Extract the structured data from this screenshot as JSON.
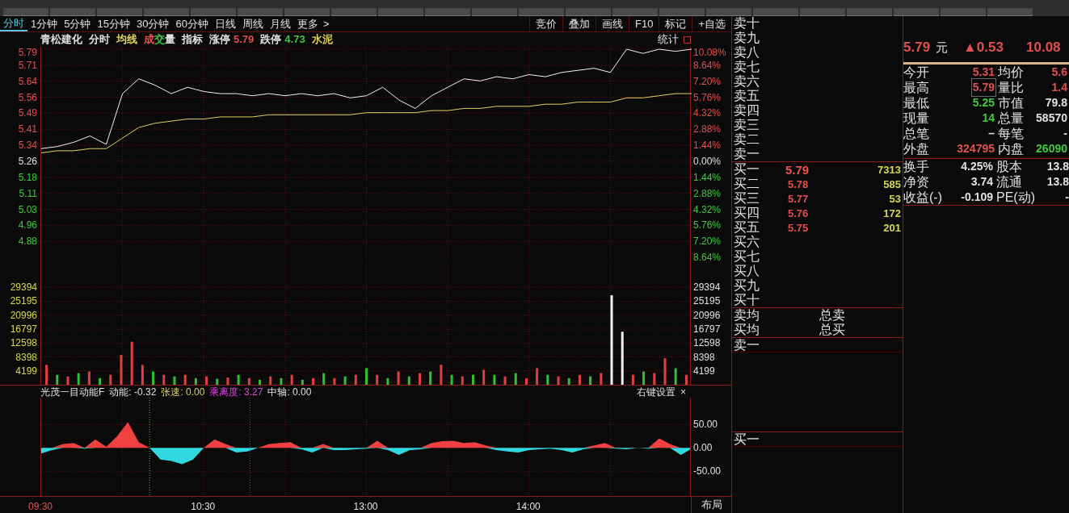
{
  "period_tabs": [
    {
      "label": "分时",
      "selected": true
    },
    {
      "label": "1分钟",
      "selected": false
    },
    {
      "label": "5分钟",
      "selected": false
    },
    {
      "label": "15分钟",
      "selected": false
    },
    {
      "label": "30分钟",
      "selected": false
    },
    {
      "label": "60分钟",
      "selected": false
    },
    {
      "label": "日线",
      "selected": false
    },
    {
      "label": "周线",
      "selected": false
    },
    {
      "label": "月线",
      "selected": false
    },
    {
      "label": "更多",
      "selected": false
    }
  ],
  "more_arrow": ">",
  "tool_buttons": [
    "竞价",
    "叠加",
    "画线",
    "F10",
    "标记",
    "+自选"
  ],
  "chart_header": {
    "items": [
      {
        "parts": [
          {
            "text": "青松建化",
            "color": "#e0e0e0"
          }
        ]
      },
      {
        "parts": [
          {
            "text": "分时",
            "color": "#e0e0e0"
          }
        ]
      },
      {
        "parts": [
          {
            "text": "均线",
            "color": "#e0d060"
          }
        ]
      },
      {
        "parts": [
          {
            "text": "成",
            "color": "#f05050"
          },
          {
            "text": "交",
            "color": "#40c840"
          },
          {
            "text": "量",
            "color": "#e0e0e0"
          }
        ]
      },
      {
        "parts": [
          {
            "text": "指标",
            "color": "#e0e0e0"
          }
        ]
      },
      {
        "parts": [
          {
            "text": "涨停",
            "color": "#e0e0e0"
          },
          {
            "text": "5.79",
            "color": "#e05050"
          }
        ]
      },
      {
        "parts": [
          {
            "text": "跌停",
            "color": "#e0e0e0"
          },
          {
            "text": "4.73",
            "color": "#40c840"
          }
        ]
      },
      {
        "parts": [
          {
            "text": "水泥",
            "color": "#e0d060"
          }
        ]
      }
    ],
    "stats_label": "统计"
  },
  "price_chart": {
    "chart_data": {
      "type": "line",
      "categories": [
        null,
        null,
        null,
        null,
        null,
        null,
        null,
        null,
        null,
        null,
        null,
        null,
        null,
        null,
        null,
        null,
        null,
        null,
        null,
        null,
        null,
        null,
        null,
        null,
        null,
        null,
        null,
        null,
        null,
        null,
        null,
        null,
        null,
        null,
        null,
        null,
        null,
        null,
        null,
        null,
        null
      ],
      "series": [
        {
          "color": "#f0f0f0",
          "values": [
            5.32,
            5.33,
            5.35,
            5.38,
            5.34,
            5.58,
            5.65,
            5.62,
            5.58,
            5.61,
            5.59,
            5.58,
            5.58,
            5.57,
            5.58,
            5.57,
            5.58,
            5.57,
            5.58,
            5.56,
            5.57,
            5.61,
            5.55,
            5.51,
            5.57,
            5.61,
            5.65,
            5.64,
            5.66,
            5.65,
            5.67,
            5.66,
            5.68,
            5.69,
            5.7,
            5.68,
            5.79,
            5.77,
            5.79,
            5.78,
            5.79
          ]
        },
        {
          "color": "#e0d060",
          "values": [
            5.3,
            5.31,
            5.31,
            5.32,
            5.32,
            5.37,
            5.42,
            5.44,
            5.45,
            5.46,
            5.46,
            5.47,
            5.47,
            5.47,
            5.48,
            5.48,
            5.48,
            5.48,
            5.48,
            5.48,
            5.49,
            5.49,
            5.49,
            5.49,
            5.5,
            5.5,
            5.51,
            5.51,
            5.52,
            5.52,
            5.52,
            5.53,
            5.53,
            5.54,
            5.54,
            5.54,
            5.56,
            5.56,
            5.57,
            5.58,
            5.58
          ]
        }
      ],
      "grid": true,
      "ylim": [
        4.73,
        5.79
      ],
      "y2lim": [
        -10.08,
        10.08
      ],
      "yticks": [
        {
          "value": 5.79,
          "label": "5.79"
        },
        {
          "value": 5.7143,
          "label": "5.71"
        },
        {
          "value": 5.6386,
          "label": "5.64"
        },
        {
          "value": 5.5629,
          "label": "5.56"
        },
        {
          "value": 5.4871,
          "label": "5.49"
        },
        {
          "value": 5.4114,
          "label": "5.41"
        },
        {
          "value": 5.3357,
          "label": "5.34"
        },
        {
          "value": 5.26,
          "label": "5.26"
        },
        {
          "value": 5.1843,
          "label": "5.18"
        },
        {
          "value": 5.1086,
          "label": "5.11"
        },
        {
          "value": 5.0329,
          "label": "5.03"
        },
        {
          "value": 4.9571,
          "label": "4.96"
        },
        {
          "value": 4.8814,
          "label": "4.88"
        }
      ],
      "y2ticks": [
        {
          "value": 10.08,
          "label": "10.08%"
        },
        {
          "value": 8.64,
          "label": "8.64%"
        },
        {
          "value": 7.2,
          "label": "7.20%"
        },
        {
          "value": 5.76,
          "label": "5.76%"
        },
        {
          "value": 4.32,
          "label": "4.32%"
        },
        {
          "value": 2.88,
          "label": "2.88%"
        },
        {
          "value": 1.44,
          "label": "1.44%"
        },
        {
          "value": 0,
          "label": "0.00%"
        },
        {
          "value": -1.44,
          "label": "1.44%"
        },
        {
          "value": -2.88,
          "label": "2.88%"
        },
        {
          "value": -4.32,
          "label": "4.32%"
        },
        {
          "value": -5.76,
          "label": "5.76%"
        },
        {
          "value": -7.2,
          "label": "7.20%"
        },
        {
          "value": -8.64,
          "label": "8.64%"
        }
      ]
    }
  },
  "volume_chart": {
    "chart_data": {
      "type": "bar",
      "grid": true,
      "categories": [
        null,
        null,
        null,
        null,
        null,
        null,
        null,
        null,
        null,
        null,
        null,
        null,
        null,
        null,
        null,
        null,
        null,
        null,
        null,
        null,
        null,
        null,
        null,
        null,
        null,
        null,
        null,
        null,
        null,
        null,
        null,
        null,
        null,
        null,
        null,
        null,
        null,
        null,
        null,
        null,
        null,
        null,
        null,
        null,
        null,
        null,
        null,
        null,
        null,
        null,
        null,
        null,
        null,
        null,
        null,
        null,
        null,
        null,
        null,
        null,
        null
      ],
      "stacked": true,
      "series": [
        {
          "color": "#e04040",
          "values": [
            6000,
            0,
            2500,
            0,
            4000,
            0,
            3000,
            9000,
            13000,
            6000,
            0,
            3000,
            0,
            3000,
            0,
            2500,
            0,
            2200,
            0,
            2000,
            0,
            2500,
            0,
            3000,
            0,
            2000,
            0,
            2000,
            0,
            3000,
            0,
            3000,
            0,
            4000,
            0,
            3500,
            0,
            6000,
            0,
            2500,
            0,
            4500,
            0,
            2500,
            0,
            2000,
            5000,
            0,
            2500,
            0,
            3000,
            0,
            3500,
            0,
            0,
            3000,
            0,
            3500,
            8000,
            0,
            3000
          ]
        },
        {
          "color": "#30c030",
          "values": [
            0,
            3000,
            0,
            3500,
            0,
            2000,
            0,
            0,
            0,
            0,
            4000,
            0,
            2500,
            0,
            2000,
            0,
            1800,
            0,
            3000,
            0,
            1500,
            0,
            2000,
            0,
            1500,
            0,
            3500,
            0,
            2500,
            0,
            5000,
            0,
            2000,
            0,
            2500,
            0,
            4000,
            0,
            3000,
            0,
            3000,
            0,
            3000,
            0,
            3500,
            0,
            0,
            3000,
            0,
            2000,
            0,
            2500,
            0,
            0,
            0,
            0,
            4000,
            0,
            0,
            5000,
            0
          ]
        },
        {
          "color": "#f0f0f0",
          "values": [
            0,
            0,
            0,
            0,
            0,
            0,
            0,
            0,
            0,
            0,
            0,
            0,
            0,
            0,
            0,
            0,
            0,
            0,
            0,
            0,
            0,
            0,
            0,
            0,
            0,
            0,
            0,
            0,
            0,
            0,
            0,
            0,
            0,
            0,
            0,
            0,
            0,
            0,
            0,
            0,
            0,
            0,
            0,
            0,
            0,
            0,
            0,
            0,
            0,
            0,
            0,
            0,
            0,
            27000,
            16000,
            0,
            0,
            0,
            0,
            0,
            0
          ]
        }
      ],
      "ylim": [
        0,
        33593
      ],
      "y2lim": [
        0,
        33593
      ],
      "yticks": [
        {
          "value": 29394,
          "label": "29394"
        },
        {
          "value": 25195,
          "label": "25195"
        },
        {
          "value": 20996,
          "label": "20996"
        },
        {
          "value": 16797,
          "label": "16797"
        },
        {
          "value": 12598,
          "label": "12598"
        },
        {
          "value": 8398,
          "label": "8398"
        },
        {
          "value": 4199,
          "label": "4199"
        }
      ],
      "y2ticks": [
        {
          "value": 29394,
          "label": "29394"
        },
        {
          "value": 25195,
          "label": "25195"
        },
        {
          "value": 20996,
          "label": "20996"
        },
        {
          "value": 16797,
          "label": "16797"
        },
        {
          "value": 12598,
          "label": "12598"
        },
        {
          "value": 8398,
          "label": "8398"
        },
        {
          "value": 4199,
          "label": "4199"
        }
      ]
    }
  },
  "indicator": {
    "header": [
      {
        "text": "光茂一目动能F",
        "color": "#e0e0e0"
      },
      {
        "text": "动能: -0.32",
        "color": "#e0e0e0"
      },
      {
        "text": "张速: 0.00",
        "color": "#e0d060"
      },
      {
        "text": "乘离度: 3.27",
        "color": "#e040e0"
      },
      {
        "text": "中轴: 0.00",
        "color": "#e0e0e0"
      }
    ],
    "settings_label": "右键设置",
    "close_glyph": "×",
    "chart_data": {
      "type": "area",
      "grid": true,
      "categories": [
        null,
        null,
        null,
        null,
        null,
        null,
        null,
        null,
        null,
        null,
        null,
        null,
        null,
        null,
        null,
        null,
        null,
        null,
        null,
        null,
        null,
        null,
        null,
        null,
        null,
        null,
        null,
        null,
        null,
        null,
        null,
        null,
        null,
        null,
        null,
        null,
        null,
        null,
        null,
        null,
        null,
        null,
        null,
        null,
        null,
        null,
        null,
        null,
        null,
        null,
        null,
        null,
        null,
        null,
        null,
        null,
        null,
        null,
        null,
        null,
        null
      ],
      "series": [
        {
          "color": "#f04040",
          "values": [
            0,
            0,
            8,
            10,
            0,
            18,
            2,
            25,
            55,
            12,
            0,
            0,
            0,
            0,
            0,
            0,
            18,
            8,
            0,
            0,
            0,
            8,
            10,
            12,
            0,
            0,
            8,
            0,
            0,
            0,
            0,
            15,
            0,
            0,
            0,
            0,
            10,
            14,
            15,
            10,
            12,
            5,
            0,
            0,
            0,
            0,
            0,
            0,
            0,
            0,
            0,
            5,
            10,
            0,
            0,
            0,
            0,
            20,
            8,
            0,
            0
          ]
        },
        {
          "color": "#30d8e0",
          "values": [
            -12,
            -5,
            0,
            0,
            -2,
            0,
            0,
            0,
            0,
            0,
            0,
            -25,
            -28,
            -35,
            -25,
            0,
            0,
            0,
            -10,
            -8,
            0,
            0,
            0,
            0,
            -3,
            -10,
            0,
            -5,
            -5,
            -3,
            -2,
            0,
            -5,
            -15,
            -5,
            -3,
            0,
            0,
            0,
            0,
            0,
            0,
            -5,
            -8,
            -10,
            -5,
            -3,
            -2,
            -5,
            -10,
            -3,
            0,
            0,
            -2,
            -3,
            0,
            -2,
            0,
            0,
            -15,
            -2
          ]
        }
      ],
      "ylim": [
        -103,
        107
      ],
      "yticks": [
        {
          "value": 50,
          "label": "50.00"
        },
        {
          "value": 0,
          "label": "0.00"
        },
        {
          "value": -50,
          "label": "-50.00"
        }
      ]
    }
  },
  "time_axis": {
    "labels": [
      "09:30",
      "10:30",
      "13:00",
      "14:00"
    ],
    "layout_button": "布局"
  },
  "order_book": {
    "sell_levels": [
      {
        "label": "卖十"
      },
      {
        "label": "卖九"
      },
      {
        "label": "卖八"
      },
      {
        "label": "卖七"
      },
      {
        "label": "卖六"
      },
      {
        "label": "卖五"
      },
      {
        "label": "卖四"
      },
      {
        "label": "卖三"
      },
      {
        "label": "卖二"
      },
      {
        "label": "卖一"
      }
    ],
    "buy_levels": [
      {
        "label": "买一",
        "price": "5.79",
        "volume": "7313"
      },
      {
        "label": "买二",
        "price": "5.78",
        "volume": "585"
      },
      {
        "label": "买三",
        "price": "5.77",
        "volume": "53"
      },
      {
        "label": "买四",
        "price": "5.76",
        "volume": "172"
      },
      {
        "label": "买五",
        "price": "5.75",
        "volume": "201"
      },
      {
        "label": "买六"
      },
      {
        "label": "买七"
      },
      {
        "label": "买八"
      },
      {
        "label": "买九"
      },
      {
        "label": "买十"
      }
    ],
    "averages": [
      {
        "label": "卖均",
        "total_label": "总卖"
      },
      {
        "label": "买均",
        "total_label": "总买"
      }
    ],
    "tick_sell_label": "卖一",
    "tick_buy_label": "买一"
  },
  "quote": {
    "price": "5.79",
    "unit": "元",
    "change": "▲0.53",
    "change_pct": "10.08",
    "rows": [
      {
        "cells": [
          {
            "label": "今开",
            "value": "5.31",
            "color": "#e05050",
            "boxed": false
          },
          {
            "label": "均价",
            "value": "5.6",
            "color": "#e05050",
            "boxed": false
          }
        ]
      },
      {
        "cells": [
          {
            "label": "最高",
            "value": "5.79",
            "color": "#e05050",
            "boxed": true
          },
          {
            "label": "量比",
            "value": "1.4",
            "color": "#e05050",
            "boxed": false
          }
        ]
      },
      {
        "cells": [
          {
            "label": "最低",
            "value": "5.25",
            "color": "#40c840",
            "boxed": false
          },
          {
            "label": "市值",
            "value": "79.8",
            "color": "#e0e0e0",
            "boxed": false
          }
        ]
      },
      {
        "cells": [
          {
            "label": "现量",
            "value": "14",
            "color": "#40c840",
            "boxed": false
          },
          {
            "label": "总量",
            "value": "58570",
            "color": "#e0e0e0",
            "boxed": false
          }
        ]
      },
      {
        "cells": [
          {
            "label": "总笔",
            "value": "–",
            "color": "#e0e0e0",
            "boxed": false
          },
          {
            "label": "每笔",
            "value": "-",
            "color": "#e0e0e0",
            "boxed": false
          }
        ]
      },
      {
        "cells": [
          {
            "label": "外盘",
            "value": "324795",
            "color": "#e05050",
            "boxed": false
          },
          {
            "label": "内盘",
            "value": "26090",
            "color": "#40c840",
            "boxed": false
          }
        ]
      }
    ],
    "rows2": [
      {
        "label": "换手",
        "value": "4.25%",
        "label2": "股本",
        "value2": "13.8"
      },
      {
        "label": "净资",
        "value": "3.74",
        "label2": "流通",
        "value2": "13.8"
      },
      {
        "label": "收益(-)",
        "value": "-0.109",
        "label2": "PE(动)",
        "value2": "-"
      }
    ]
  }
}
